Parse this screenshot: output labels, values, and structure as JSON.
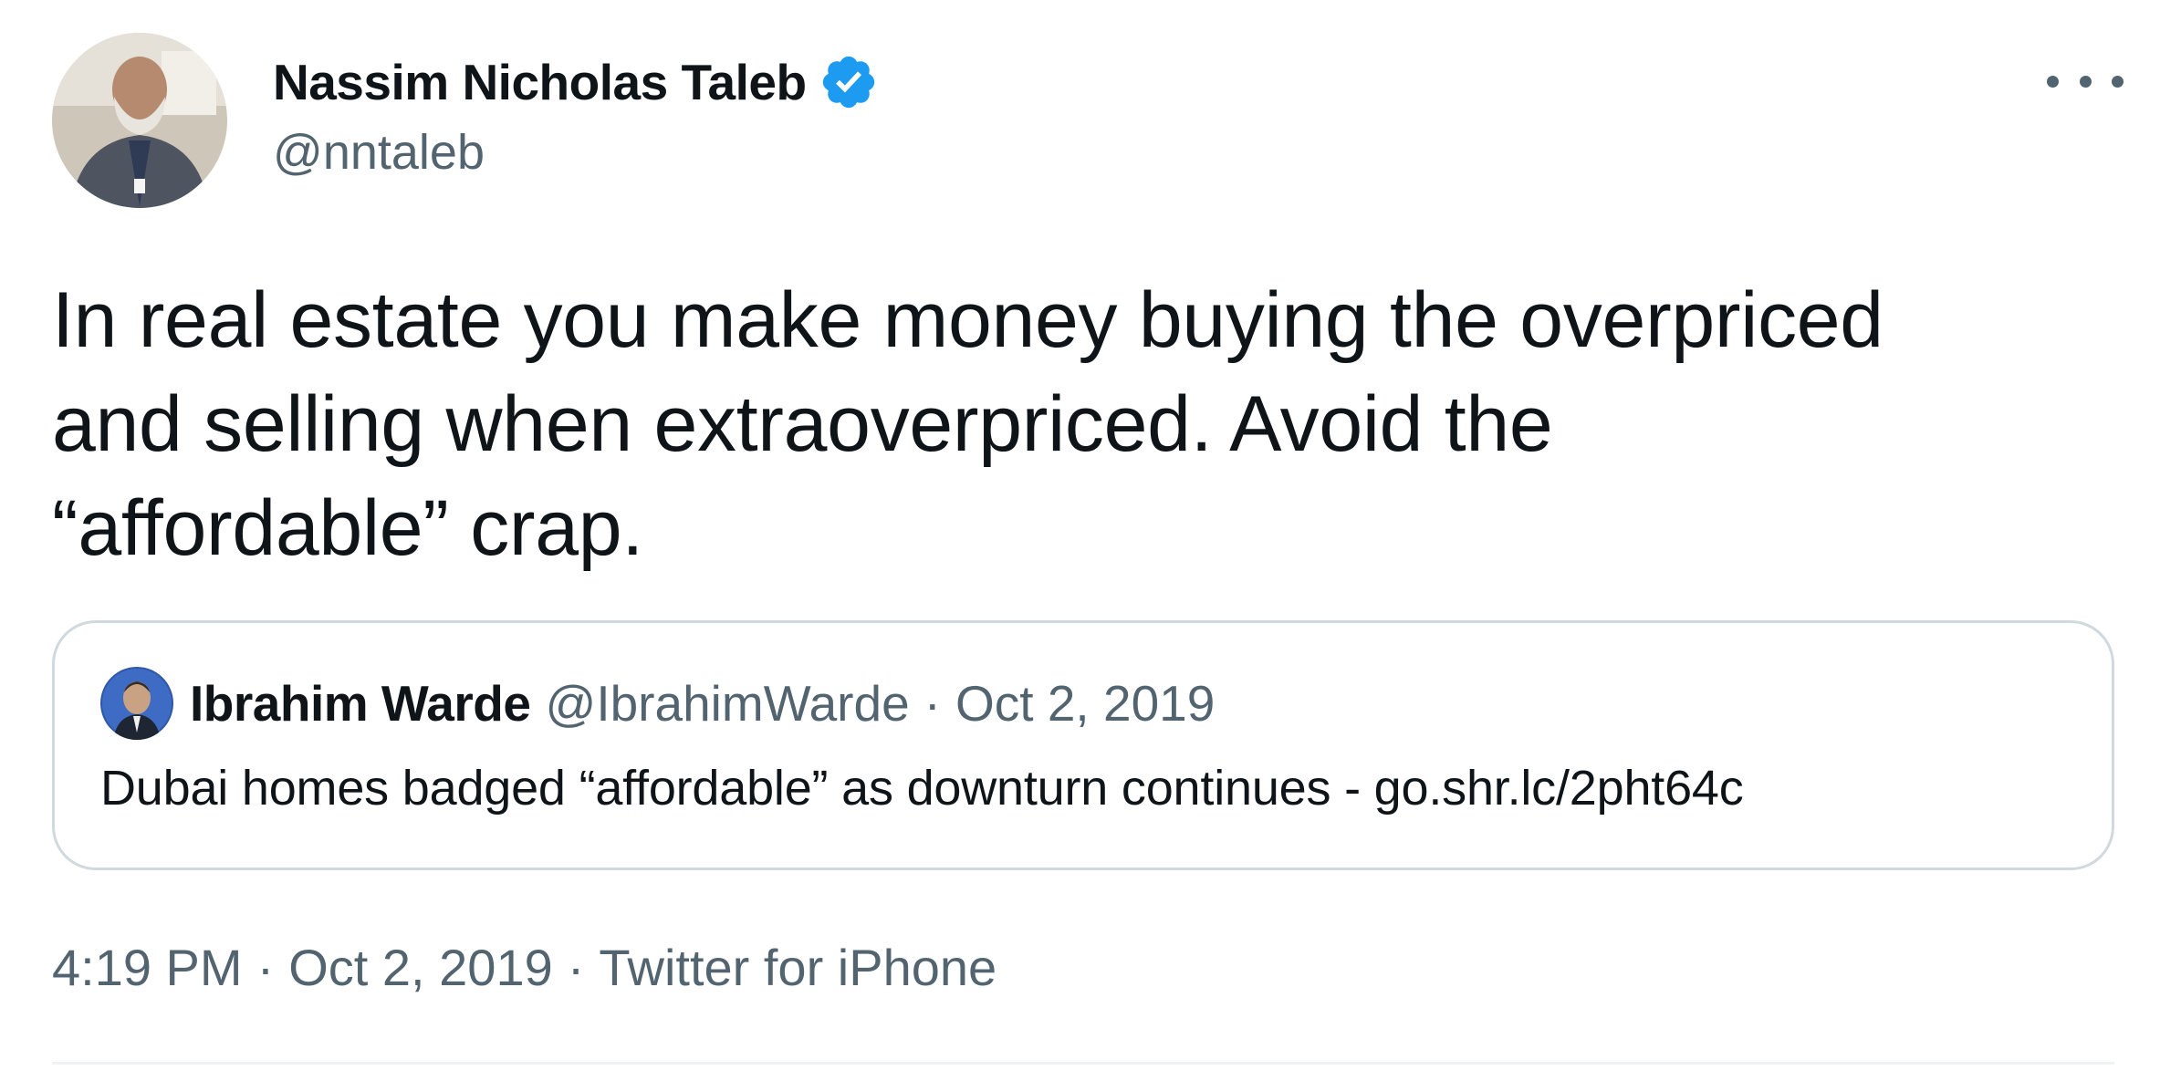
{
  "tweet": {
    "author": {
      "name": "Nassim Nicholas Taleb",
      "handle": "@nntaleb",
      "verified": true
    },
    "text_lines": [
      "In real estate you make money buying the overpriced",
      "and selling when extraoverpriced. Avoid the",
      "“affordable” crap."
    ],
    "quoted": {
      "name": "Ibrahim Warde",
      "handle": "@IbrahimWarde",
      "separator": "·",
      "date": "Oct 2, 2019",
      "text": "Dubai homes badged “affordable” as downturn continues - go.shr.lc/2pht64c"
    },
    "meta": {
      "time": "4:19 PM",
      "separator": "·",
      "date": "Oct 2, 2019",
      "source": "Twitter for iPhone"
    }
  },
  "icons": {
    "verified": "verified-badge-icon",
    "more": "more-options-icon"
  },
  "colors": {
    "primary_text": "#0f1419",
    "secondary_text": "#536471",
    "verified_blue": "#1d9bf0",
    "card_border": "#cfd9de",
    "divider": "#eff3f4",
    "background": "#ffffff"
  }
}
